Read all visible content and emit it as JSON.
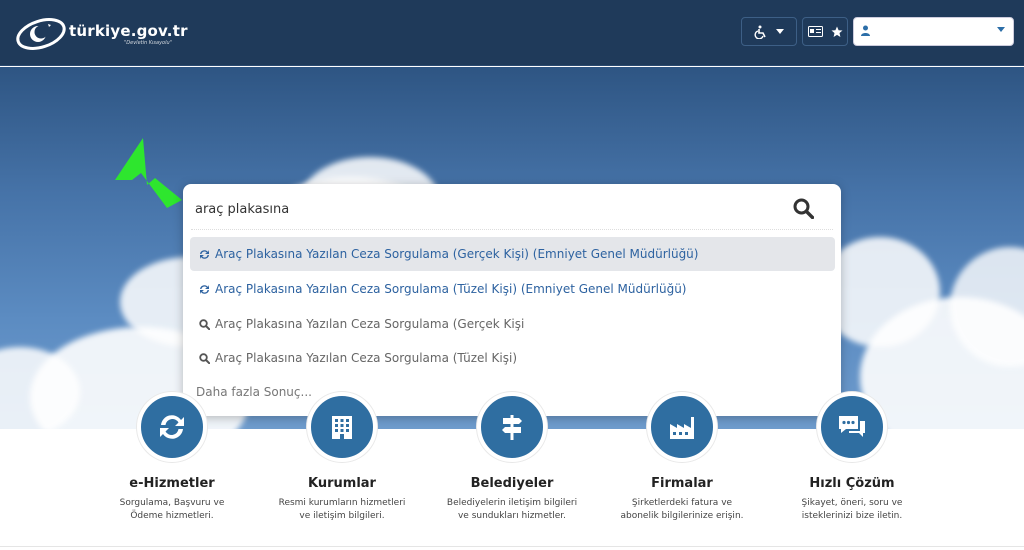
{
  "header": {
    "brand": "türkiye.gov.tr",
    "tagline": "\"Devletin Kısayolu\""
  },
  "search": {
    "value": "araç plakasına",
    "suggestions": [
      {
        "type": "service",
        "label": "Araç Plakasına Yazılan Ceza Sorgulama (Gerçek Kişi) (Emniyet Genel Müdürlüğü)"
      },
      {
        "type": "service",
        "label": "Araç Plakasına Yazılan Ceza Sorgulama (Tüzel Kişi) (Emniyet Genel Müdürlüğü)"
      },
      {
        "type": "query",
        "label": "Araç Plakasına Yazılan Ceza Sorgulama (Gerçek Kişi"
      },
      {
        "type": "query",
        "label": "Araç Plakasına Yazılan Ceza Sorgulama (Tüzel Kişi)"
      }
    ],
    "more": "Daha fazla Sonuç..."
  },
  "categories": [
    {
      "title": "e-Hizmetler",
      "desc": "Sorgulama, Başvuru ve Ödeme hizmetleri.",
      "icon": "refresh-icon"
    },
    {
      "title": "Kurumlar",
      "desc": "Resmi kurumların hizmetleri ve iletişim bilgileri.",
      "icon": "building-icon"
    },
    {
      "title": "Belediyeler",
      "desc": "Belediyelerin iletişim bilgileri ve sundukları hizmetler.",
      "icon": "signpost-icon"
    },
    {
      "title": "Firmalar",
      "desc": "Şirketlerdeki fatura ve abonelik bilgilerinize erişin.",
      "icon": "factory-icon"
    },
    {
      "title": "Hızlı Çözüm",
      "desc": "Şikayet, öneri, soru ve isteklerinizi bize iletin.",
      "icon": "chat-icon"
    }
  ],
  "colors": {
    "header_bg": "#1f3a5a",
    "accent": "#2f6ea1",
    "link": "#2d62a0",
    "pointer": "#2ee62e"
  }
}
